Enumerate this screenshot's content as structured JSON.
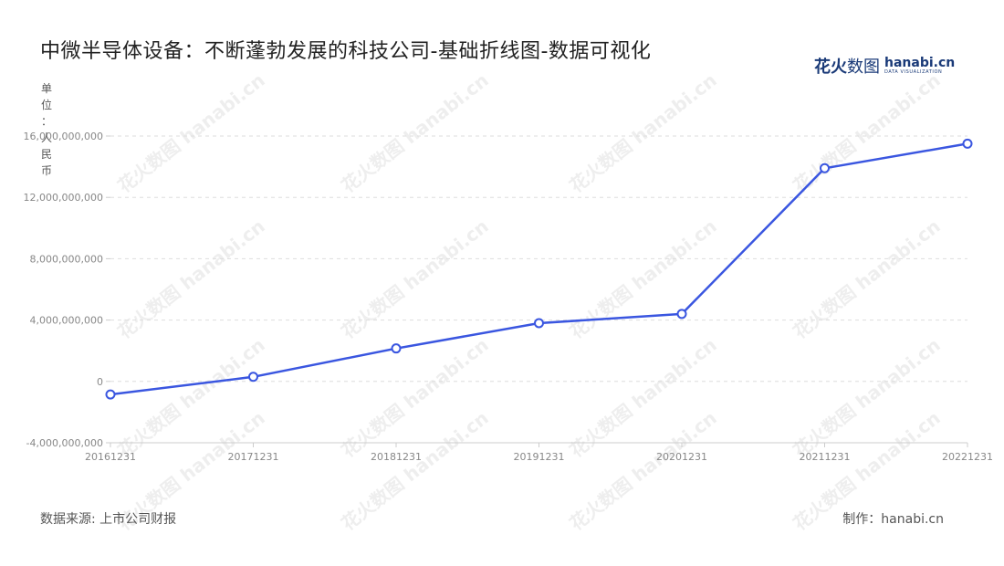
{
  "title": "中微半导体设备：不断蓬勃发展的科技公司-基础折线图-数据可视化",
  "logo": {
    "cn_bold": "花火",
    "cn_thin": "数图",
    "en": "hanabi.cn",
    "en_sub": "DATA VISUALIZATION"
  },
  "unit_chars": [
    "单",
    "位",
    "：",
    "人",
    "民",
    "币"
  ],
  "footer": {
    "source": "数据来源: 上市公司财报",
    "maker": "制作：hanabi.cn"
  },
  "watermark": "花火数图 hanabi.cn",
  "colors": {
    "line": "#3a56e0",
    "grid": "#dddddd",
    "axis": "#cccccc",
    "tick_text": "#888888"
  },
  "chart_data": {
    "type": "line",
    "title": "中微半导体设备：不断蓬勃发展的科技公司-基础折线图-数据可视化",
    "ylabel": "单位：人民币",
    "xlabel": "",
    "categories": [
      "20161231",
      "20171231",
      "20181231",
      "20191231",
      "20201231",
      "20211231",
      "20221231"
    ],
    "series": [
      {
        "values": [
          -850000000,
          300000000,
          2150000000,
          3800000000,
          4400000000,
          13900000000,
          15500000000
        ]
      }
    ],
    "yticks": [
      -4000000000,
      0,
      4000000000,
      8000000000,
      12000000000,
      16000000000
    ],
    "ytick_labels": [
      "-4,000,000,000",
      "0",
      "4,000,000,000",
      "8,000,000,000",
      "12,000,000,000",
      "16,000,000,000"
    ],
    "ylim": [
      -4000000000,
      16000000000
    ],
    "grid": true,
    "legend": "none"
  }
}
